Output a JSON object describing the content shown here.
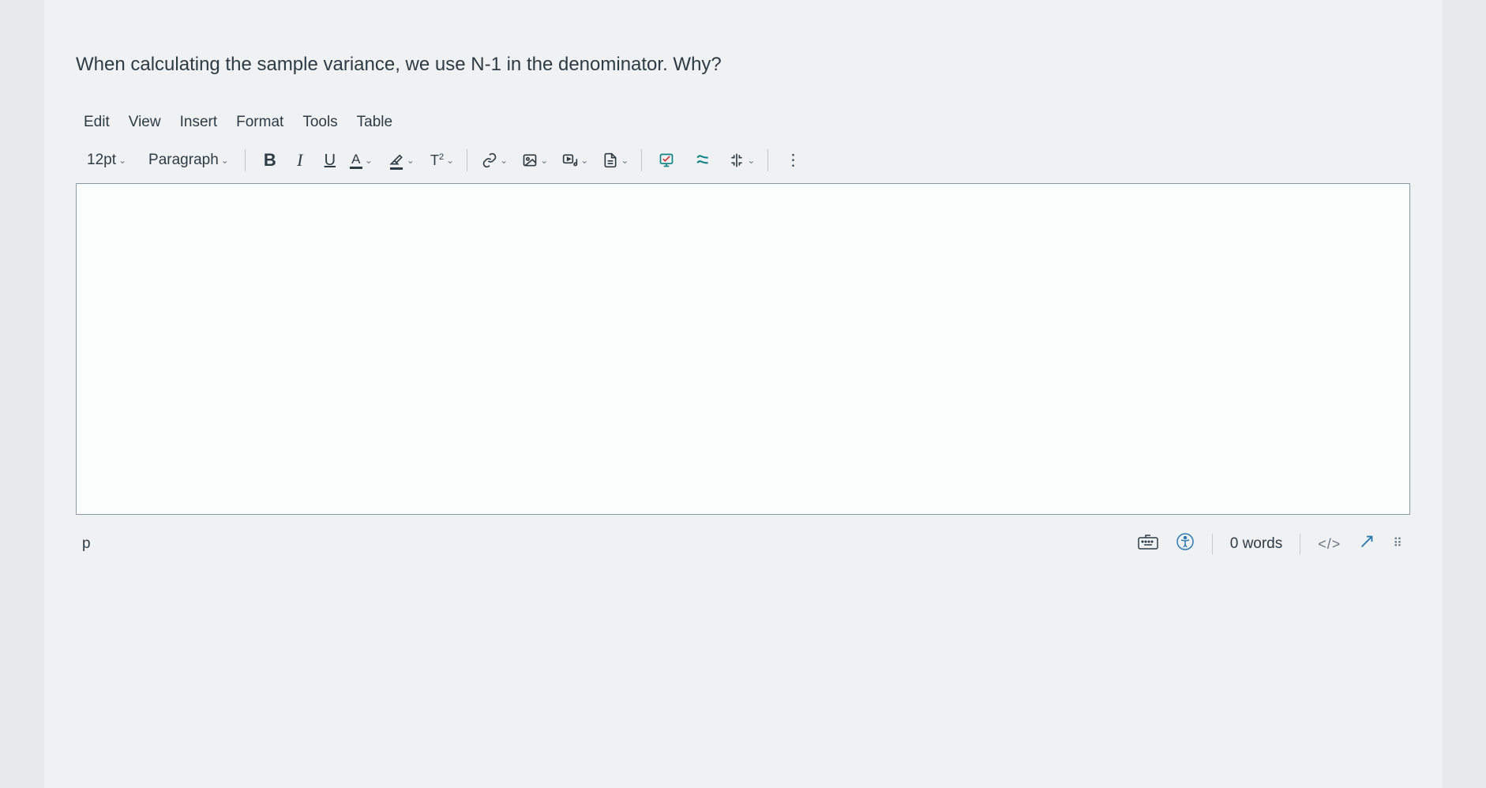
{
  "question": {
    "prompt": "When calculating the sample variance, we use N-1 in the denominator. Why?"
  },
  "menubar": {
    "items": [
      "Edit",
      "View",
      "Insert",
      "Format",
      "Tools",
      "Table"
    ]
  },
  "toolbar": {
    "font_size": "12pt",
    "block_format": "Paragraph"
  },
  "editor": {
    "content": ""
  },
  "statusbar": {
    "path": "p",
    "word_count": "0 words",
    "html_view": "</>"
  }
}
